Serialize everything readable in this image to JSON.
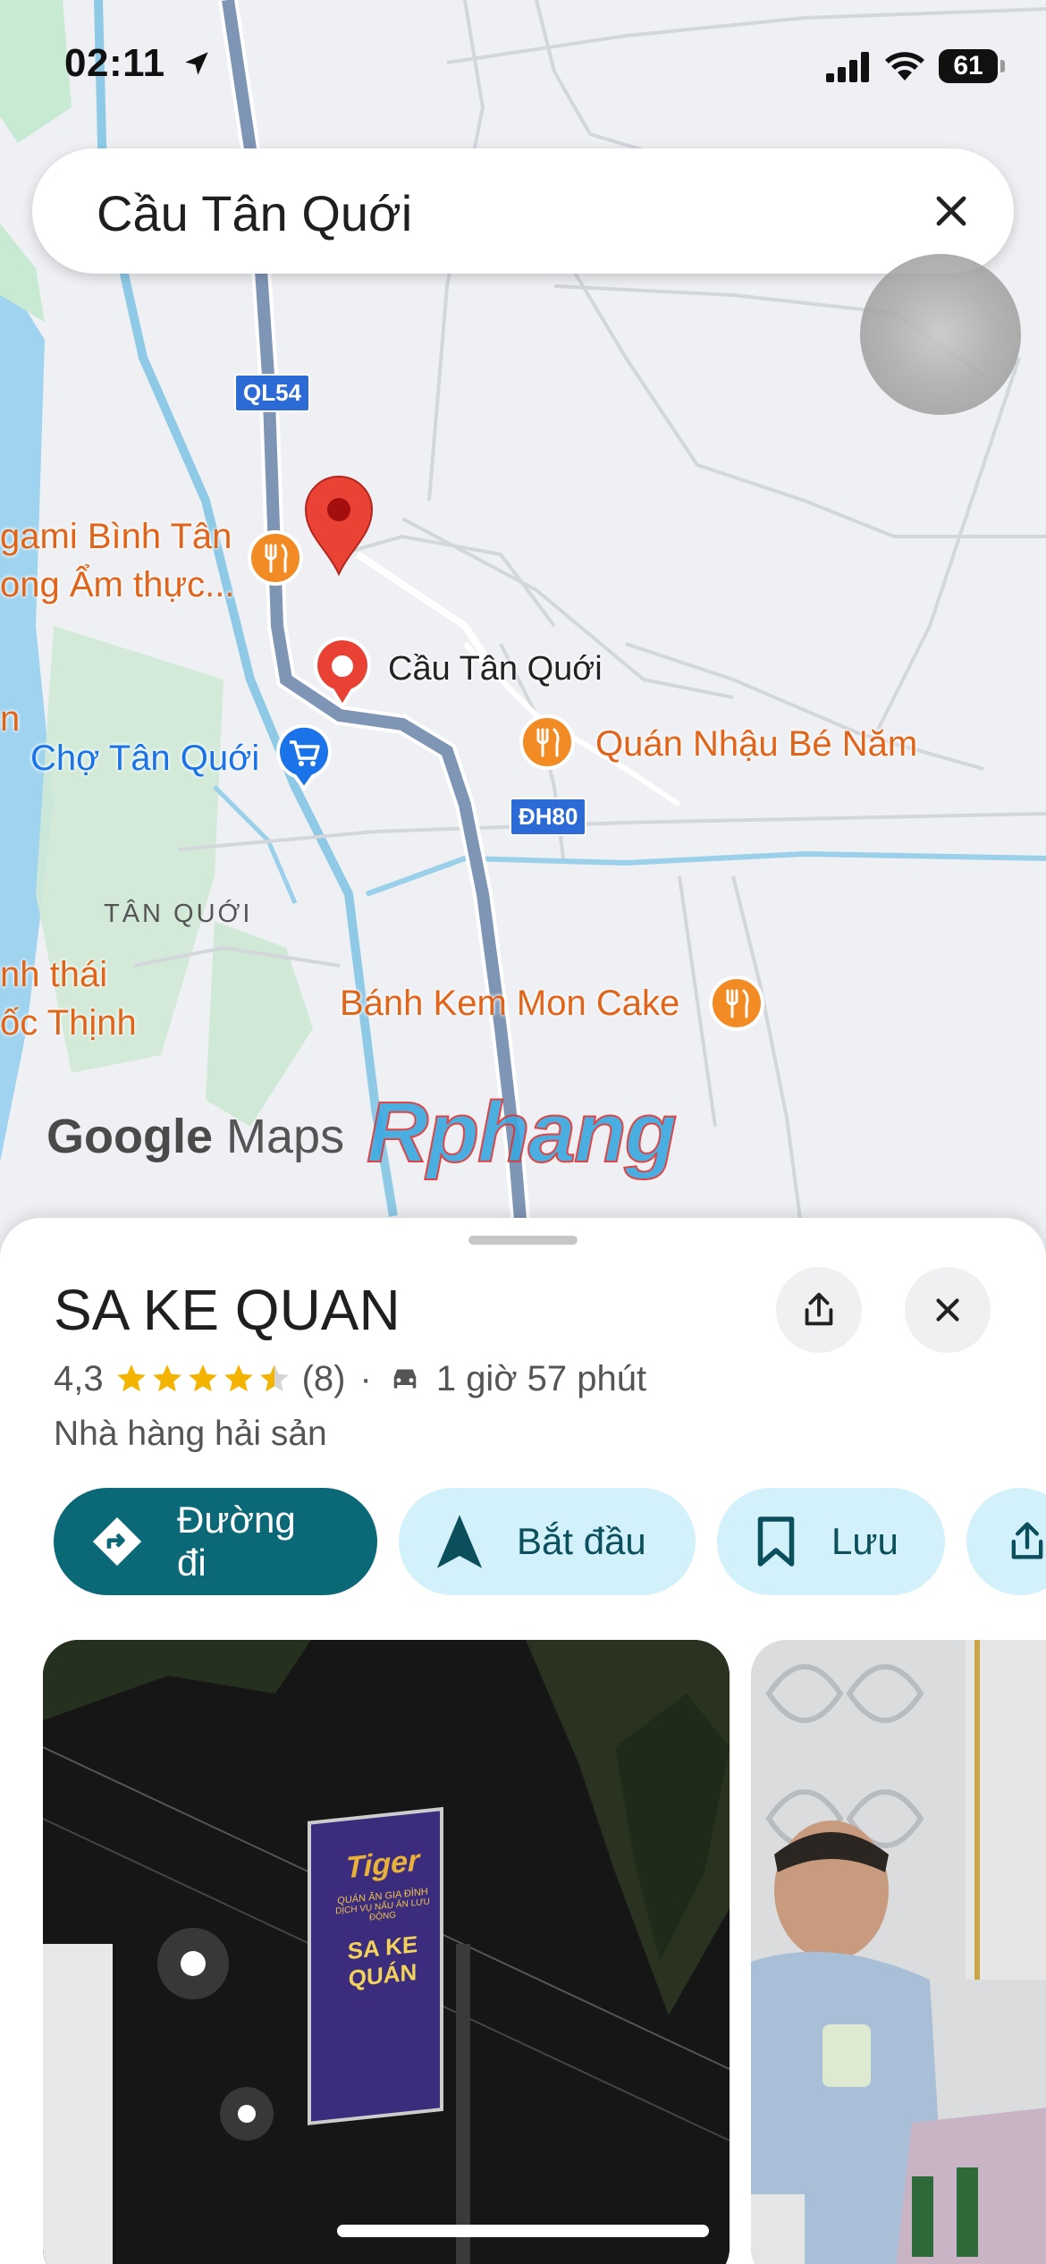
{
  "status_bar": {
    "time": "02:11",
    "battery": "61"
  },
  "search": {
    "query": "Cầu Tân Quới"
  },
  "map": {
    "road_shields": [
      "QL54",
      "ĐH80"
    ],
    "area_label": "TÂN QUỚI",
    "poi_labels": [
      {
        "text": "gami Bình Tân",
        "type": "restaurant"
      },
      {
        "text": "ong Ẩm thực...",
        "type": "restaurant"
      },
      {
        "text": "Chợ Tân Quới",
        "type": "shopping"
      },
      {
        "text": "Quán Nhậu Bé Năm",
        "type": "restaurant"
      },
      {
        "text": "Bánh Kem Mon Cake",
        "type": "restaurant"
      },
      {
        "text": "nh thái",
        "type": "restaurant"
      },
      {
        "text": "ốc Thịnh",
        "type": "restaurant"
      },
      {
        "text": "n",
        "type": "restaurant"
      }
    ],
    "place_pin_label": "Cầu Tân Quới",
    "logo_google": "Google",
    "logo_maps": "Maps",
    "watermark": "Rphang"
  },
  "place": {
    "name": "SA KE QUAN",
    "rating": "4,3",
    "stars": 4.3,
    "review_count": "(8)",
    "separator": "·",
    "drive_time": "1 giờ 57 phút",
    "category": "Nhà hàng hải sản"
  },
  "actions": [
    {
      "label": "Đường đi",
      "icon": "directions-icon"
    },
    {
      "label": "Bắt đầu",
      "icon": "navigation-arrow-icon"
    },
    {
      "label": "Lưu",
      "icon": "bookmark-icon"
    }
  ],
  "photos": [
    {
      "sign_lines": [
        "Tiger",
        "QUÁN ĂN GIA ĐÌNH",
        "DỊCH VỤ NẤU ĂN LƯU ĐỘNG",
        "SA KE QUÁN"
      ]
    }
  ],
  "colors": {
    "primary": "#0b6877",
    "secondary": "#d2f1fb",
    "poi": "#e0651a",
    "pin": "#ea4335",
    "shop": "#1a73e8"
  }
}
